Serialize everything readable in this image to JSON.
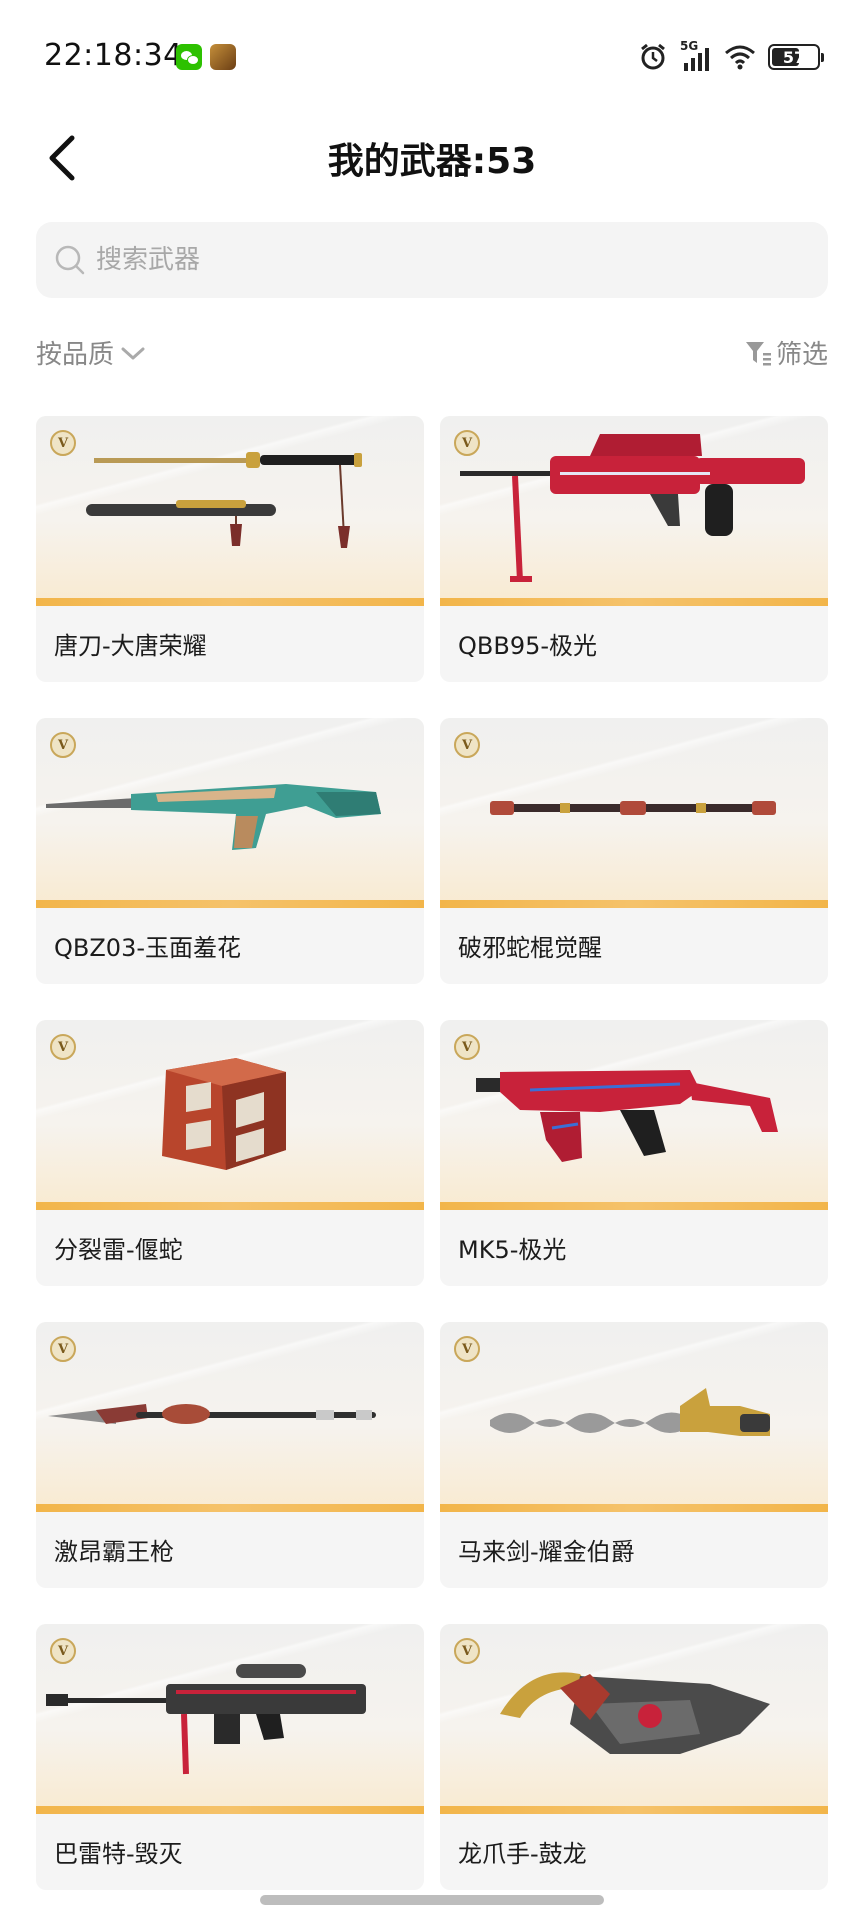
{
  "status_bar": {
    "time": "22:18:34",
    "signal_label": "5G",
    "battery": "57",
    "icons": [
      "wechat-icon",
      "game-app-icon",
      "alarm-icon",
      "signal-icon",
      "wifi-icon",
      "battery-icon"
    ]
  },
  "header": {
    "title": "我的武器:53",
    "back_icon": "chevron-left-icon"
  },
  "search": {
    "placeholder": "搜索武器",
    "value": ""
  },
  "sort": {
    "label": "按品质",
    "icon": "chevron-down-icon"
  },
  "filter": {
    "label": "筛选",
    "icon": "funnel-icon"
  },
  "badge_label": "V",
  "weapons": [
    {
      "name": "唐刀-大唐荣耀",
      "art": "katana"
    },
    {
      "name": "QBB95-极光",
      "art": "lmg"
    },
    {
      "name": "QBZ03-玉面羞花",
      "art": "rifle"
    },
    {
      "name": "破邪蛇棍觉醒",
      "art": "staff"
    },
    {
      "name": "分裂雷-偃蛇",
      "art": "grenade"
    },
    {
      "name": "MK5-极光",
      "art": "smg"
    },
    {
      "name": "激昂霸王枪",
      "art": "spear"
    },
    {
      "name": "马来剑-耀金伯爵",
      "art": "kris"
    },
    {
      "name": "巴雷特-毁灭",
      "art": "sniper"
    },
    {
      "name": "龙爪手-鼓龙",
      "art": "claw"
    }
  ],
  "colors": {
    "accent_gold": "#f2b54a",
    "card_bg": "#f5f5f5",
    "weapon_red": "#c8223a"
  }
}
